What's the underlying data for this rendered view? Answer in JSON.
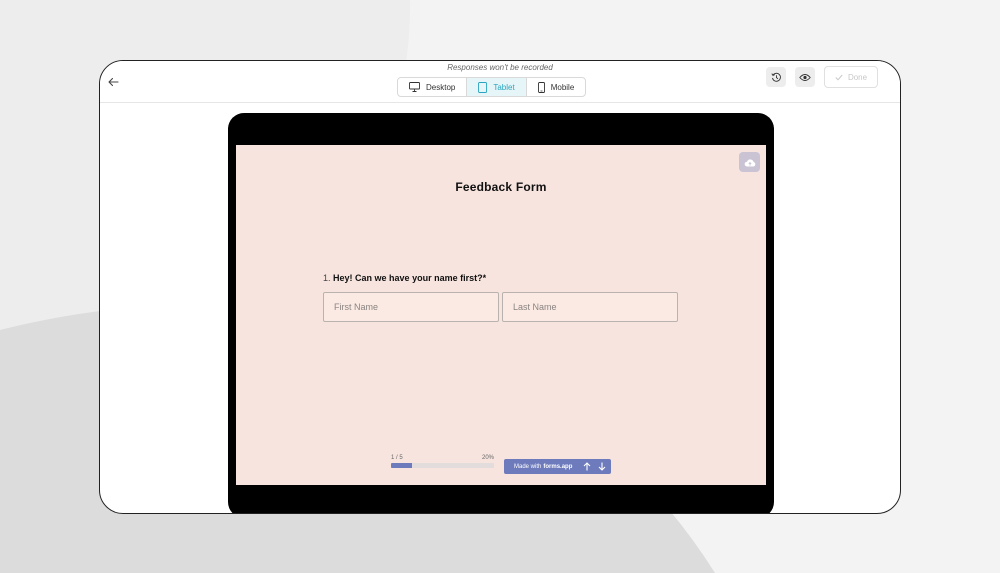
{
  "preview": {
    "notice": "Responses won't be recorded",
    "device_tabs": [
      {
        "label": "Desktop",
        "icon": "desktop-icon",
        "active": false
      },
      {
        "label": "Tablet",
        "icon": "tablet-icon",
        "active": true
      },
      {
        "label": "Mobile",
        "icon": "mobile-icon",
        "active": false
      }
    ],
    "done_label": "Done"
  },
  "form": {
    "title": "Feedback Form",
    "question_number": "1.",
    "question_text": "Hey! Can we have your name first?",
    "required_mark": "*",
    "first_name_placeholder": "First Name",
    "last_name_placeholder": "Last Name"
  },
  "footer": {
    "progress_label": "1 / 5",
    "progress_percent_label": "20%",
    "progress_fraction": 0.2,
    "made_with_prefix": "Made with",
    "made_with_brand": "forms.app"
  },
  "colors": {
    "accent": "#28a6bf",
    "form_background": "#f7e4de",
    "brand_bar": "#6d7bbd"
  }
}
